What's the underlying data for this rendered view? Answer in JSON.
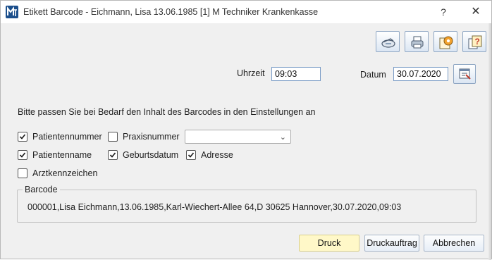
{
  "window": {
    "title": "Etikett Barcode - Eichmann, Lisa 13.06.1985 [1] M Techniker Krankenkasse",
    "help_glyph": "?",
    "close_glyph": "✕"
  },
  "toolbar": {
    "icons": [
      "scanner-icon",
      "printer-icon",
      "settings-gear-icon",
      "help-book-icon"
    ]
  },
  "time": {
    "label": "Uhrzeit",
    "value": "09:03"
  },
  "date": {
    "label": "Datum",
    "value": "30.07.2020"
  },
  "hint": "Bitte passen Sie bei Bedarf den Inhalt des Barcodes in den Einstellungen an",
  "options": {
    "patientennummer": {
      "label": "Patientennummer",
      "checked": true
    },
    "praxisnummer": {
      "label": "Praxisnummer",
      "checked": false
    },
    "praxis_select_value": "",
    "patientenname": {
      "label": "Patientenname",
      "checked": true
    },
    "geburtsdatum": {
      "label": "Geburtsdatum",
      "checked": true
    },
    "adresse": {
      "label": "Adresse",
      "checked": true
    },
    "arztkennzeichen": {
      "label": "Arztkennzeichen",
      "checked": false
    }
  },
  "barcode": {
    "legend": "Barcode",
    "content": "000001,Lisa Eichmann,13.06.1985,Karl-Wiechert-Allee 64,D 30625 Hannover,30.07.2020,09:03"
  },
  "buttons": {
    "druck": "Druck",
    "druckauftrag": "Druckauftrag",
    "abbrechen": "Abbrechen"
  },
  "colors": {
    "accent": "#1c4f8c",
    "primary_button": "#fff8c8",
    "field_border": "#7a9cc6"
  }
}
